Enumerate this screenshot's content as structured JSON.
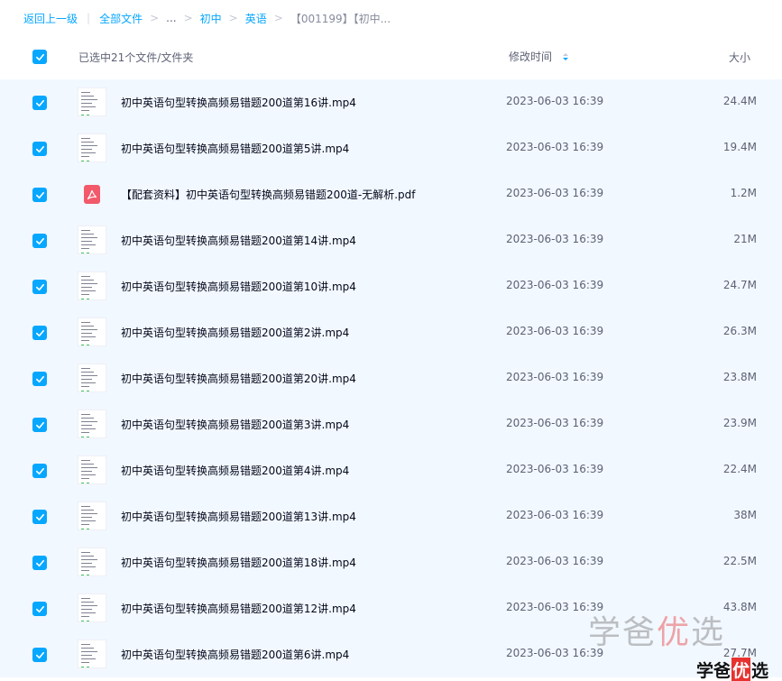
{
  "breadcrumb": {
    "back": "返回上一级",
    "all_files": "全部文件",
    "ellipsis": "...",
    "level1": "初中",
    "level2": "英语",
    "current": "【001199】【初中..."
  },
  "header": {
    "selected_text": "已选中21个文件/文件夹",
    "col_time": "修改时间",
    "col_size": "大小",
    "all_checked": true
  },
  "files": [
    {
      "name": "初中英语句型转换高频易错题200道第16讲.mp4",
      "type": "video",
      "time": "2023-06-03 16:39",
      "size": "24.4M",
      "checked": true
    },
    {
      "name": "初中英语句型转换高频易错题200道第5讲.mp4",
      "type": "video",
      "time": "2023-06-03 16:39",
      "size": "19.4M",
      "checked": true
    },
    {
      "name": "【配套资料】初中英语句型转换高频易错题200道-无解析.pdf",
      "type": "pdf",
      "time": "2023-06-03 16:39",
      "size": "1.2M",
      "checked": true
    },
    {
      "name": "初中英语句型转换高频易错题200道第14讲.mp4",
      "type": "video",
      "time": "2023-06-03 16:39",
      "size": "21M",
      "checked": true
    },
    {
      "name": "初中英语句型转换高频易错题200道第10讲.mp4",
      "type": "video",
      "time": "2023-06-03 16:39",
      "size": "24.7M",
      "checked": true
    },
    {
      "name": "初中英语句型转换高频易错题200道第2讲.mp4",
      "type": "video",
      "time": "2023-06-03 16:39",
      "size": "26.3M",
      "checked": true
    },
    {
      "name": "初中英语句型转换高频易错题200道第20讲.mp4",
      "type": "video",
      "time": "2023-06-03 16:39",
      "size": "23.8M",
      "checked": true
    },
    {
      "name": "初中英语句型转换高频易错题200道第3讲.mp4",
      "type": "video",
      "time": "2023-06-03 16:39",
      "size": "23.9M",
      "checked": true
    },
    {
      "name": "初中英语句型转换高频易错题200道第4讲.mp4",
      "type": "video",
      "time": "2023-06-03 16:39",
      "size": "22.4M",
      "checked": true
    },
    {
      "name": "初中英语句型转换高频易错题200道第13讲.mp4",
      "type": "video",
      "time": "2023-06-03 16:39",
      "size": "38M",
      "checked": true
    },
    {
      "name": "初中英语句型转换高频易错题200道第18讲.mp4",
      "type": "video",
      "time": "2023-06-03 16:39",
      "size": "22.5M",
      "checked": true
    },
    {
      "name": "初中英语句型转换高频易错题200道第12讲.mp4",
      "type": "video",
      "time": "2023-06-03 16:39",
      "size": "43.8M",
      "checked": true
    },
    {
      "name": "初中英语句型转换高频易错题200道第6讲.mp4",
      "type": "video",
      "time": "2023-06-03 16:39",
      "size": "27.7M",
      "checked": true
    }
  ],
  "watermark": {
    "part1": "学爸",
    "part2": "优",
    "part3": "选"
  },
  "brand": {
    "part1": "学爸",
    "part2": "优",
    "part3": "选"
  },
  "colors": {
    "accent": "#06a7ff",
    "row_selected_bg": "#f2f8ff",
    "pdf_red": "#f2596a"
  }
}
